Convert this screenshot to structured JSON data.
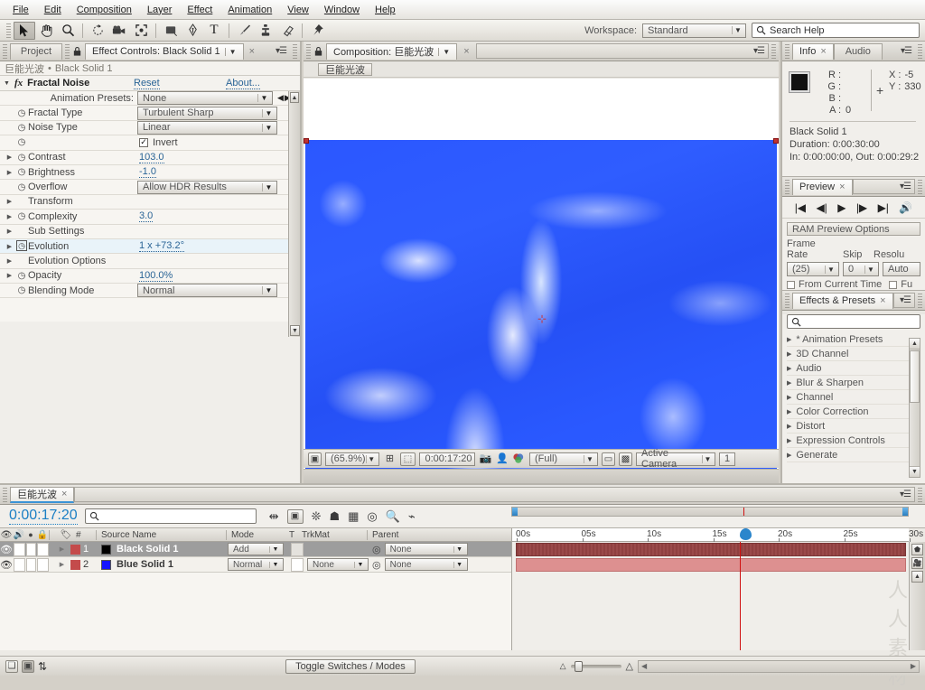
{
  "app": {
    "title": "Adobe After Effects"
  },
  "menubar": {
    "items": [
      "File",
      "Edit",
      "Composition",
      "Layer",
      "Effect",
      "Animation",
      "View",
      "Window",
      "Help"
    ]
  },
  "toolbar": {
    "tools": [
      {
        "name": "selection-tool",
        "glyph": "➤",
        "selected": true
      },
      {
        "name": "hand-tool",
        "glyph": "✋",
        "selected": false
      },
      {
        "name": "zoom-tool",
        "glyph": "🔍",
        "selected": false
      },
      {
        "name": "rotation-tool",
        "glyph": "↻",
        "selected": false
      },
      {
        "name": "camera-tool",
        "glyph": "🎥",
        "selected": false
      },
      {
        "name": "pan-behind-tool",
        "glyph": "✥",
        "selected": false
      },
      {
        "name": "shape-tool",
        "glyph": "▢",
        "selected": false
      },
      {
        "name": "pen-tool",
        "glyph": "✒",
        "selected": false
      },
      {
        "name": "text-tool",
        "glyph": "T",
        "selected": false
      },
      {
        "name": "brush-tool",
        "glyph": "🖌",
        "selected": false
      },
      {
        "name": "clone-stamp-tool",
        "glyph": "⚲",
        "selected": false
      },
      {
        "name": "eraser-tool",
        "glyph": "◳",
        "selected": false
      },
      {
        "name": "puppet-pin-tool",
        "glyph": "📌",
        "selected": false
      }
    ],
    "workspace_label": "Workspace:",
    "workspace_value": "Standard",
    "search_placeholder": "Search Help",
    "search_value": "Search Help"
  },
  "project_panel": {
    "tab_label": "Project"
  },
  "effect_controls": {
    "tab_label": "Effect Controls: Black Solid 1",
    "breadcrumb_comp": "巨能光波",
    "breadcrumb_sep": "•",
    "breadcrumb_layer": "Black Solid 1",
    "effect_name": "Fractal Noise",
    "reset_label": "Reset",
    "about_label": "About...",
    "rows": [
      {
        "label": "Animation Presets:",
        "type": "dropdown",
        "value": "None",
        "indent": 0,
        "stopwatch": false,
        "twirl": false
      },
      {
        "label": "Fractal Type",
        "type": "dropdown",
        "value": "Turbulent Sharp",
        "indent": 1,
        "stopwatch": true,
        "twirl": false
      },
      {
        "label": "Noise Type",
        "type": "dropdown",
        "value": "Linear",
        "indent": 1,
        "stopwatch": true,
        "twirl": false
      },
      {
        "label": "",
        "type": "checkbox",
        "value": "Invert",
        "indent": 1,
        "stopwatch": true,
        "twirl": false,
        "checked": true
      },
      {
        "label": "Contrast",
        "type": "value",
        "value": "103.0",
        "indent": 1,
        "stopwatch": true,
        "twirl": true
      },
      {
        "label": "Brightness",
        "type": "value",
        "value": "-1.0",
        "indent": 1,
        "stopwatch": true,
        "twirl": true
      },
      {
        "label": "Overflow",
        "type": "dropdown",
        "value": "Allow HDR Results",
        "indent": 1,
        "stopwatch": true,
        "twirl": false
      },
      {
        "label": "Transform",
        "type": "group",
        "value": "",
        "indent": 1,
        "stopwatch": false,
        "twirl": true
      },
      {
        "label": "Complexity",
        "type": "value",
        "value": "3.0",
        "indent": 1,
        "stopwatch": true,
        "twirl": true
      },
      {
        "label": "Sub Settings",
        "type": "group",
        "value": "",
        "indent": 1,
        "stopwatch": false,
        "twirl": true
      },
      {
        "label": "Evolution",
        "type": "value",
        "value": "1 x +73.2°",
        "indent": 1,
        "stopwatch": true,
        "twirl": true,
        "highlight": true
      },
      {
        "label": "Evolution Options",
        "type": "group",
        "value": "",
        "indent": 1,
        "stopwatch": false,
        "twirl": true
      },
      {
        "label": "Opacity",
        "type": "value",
        "value": "100.0%",
        "indent": 1,
        "stopwatch": true,
        "twirl": true
      },
      {
        "label": "Blending Mode",
        "type": "dropdown",
        "value": "Normal",
        "indent": 1,
        "stopwatch": true,
        "twirl": false
      }
    ]
  },
  "composition_panel": {
    "tab_label": "Composition: 巨能光波",
    "sub_tab_label": "巨能光波",
    "footer": {
      "zoom": "(65.9%)",
      "time": "0:00:17:20",
      "resolution": "(Full)",
      "view": "Active Camera",
      "views_count": "1"
    }
  },
  "info_panel": {
    "tab_label": "Info",
    "audio_tab_label": "Audio",
    "channels": [
      {
        "label": "R :",
        "value": ""
      },
      {
        "label": "G :",
        "value": ""
      },
      {
        "label": "B :",
        "value": ""
      },
      {
        "label": "A :",
        "value": "0"
      }
    ],
    "x_label": "X :",
    "x_value": "-5",
    "y_label": "Y :",
    "y_value": "330",
    "layer_name": "Black Solid 1",
    "duration": "Duration: 0:00:30:00",
    "inout": "In: 0:00:00:00, Out: 0:00:29:2"
  },
  "preview_panel": {
    "tab_label": "Preview",
    "transport": [
      "first-frame",
      "prev-frame",
      "play",
      "next-frame",
      "last-frame",
      "audio"
    ],
    "ram_preview_options": "RAM Preview Options",
    "frame_rate_label": "Frame Rate",
    "frame_rate_value": "(25)",
    "skip_label": "Skip",
    "skip_value": "0",
    "resolution_label": "Resolu",
    "resolution_value": "Auto",
    "from_current_time_label": "From Current Time",
    "full_screen_label": "Fu"
  },
  "effects_presets_panel": {
    "tab_label": "Effects & Presets",
    "search_placeholder": "",
    "categories": [
      "* Animation Presets",
      "3D Channel",
      "Audio",
      "Blur & Sharpen",
      "Channel",
      "Color Correction",
      "Distort",
      "Expression Controls",
      "Generate"
    ]
  },
  "timeline_panel": {
    "tab_label": "巨能光波",
    "current_time": "0:00:17:20",
    "search_placeholder": "",
    "columns": {
      "num": "#",
      "source_name": "Source Name",
      "mode": "Mode",
      "t": "T",
      "trkmat": "TrkMat",
      "parent": "Parent"
    },
    "layers": [
      {
        "index": "1",
        "name": "Black Solid 1",
        "swatch": "#000000",
        "label_color": "#c44b4b",
        "mode": "Add",
        "trkmat": "",
        "parent": "None",
        "selected": true
      },
      {
        "index": "2",
        "name": "Blue Solid 1",
        "swatch": "#1414ff",
        "label_color": "#c44b4b",
        "mode": "Normal",
        "trkmat": "None",
        "parent": "None",
        "selected": false
      }
    ],
    "ruler_ticks": [
      "00s",
      "05s",
      "10s",
      "15s",
      "20s",
      "25s",
      "30s"
    ],
    "toggle_switches_modes": "Toggle Switches / Modes"
  },
  "watermark": {
    "text": "人人素材"
  },
  "colors": {
    "accent_blue": "#2a6496",
    "highlight_row": "#e9f3f9",
    "panel_bg": "#d4d0c8",
    "layer_red": "#c44b4b",
    "playhead_red": "#d01010",
    "time_blue": "#1b7fc4"
  }
}
